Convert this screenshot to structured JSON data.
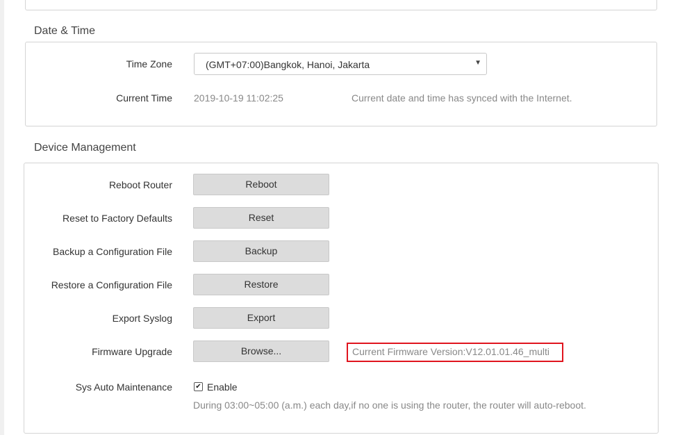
{
  "date_time": {
    "title": "Date & Time",
    "time_zone": {
      "label": "Time Zone",
      "selected": "(GMT+07:00)Bangkok, Hanoi, Jakarta"
    },
    "current_time": {
      "label": "Current Time",
      "value": "2019-10-19 11:02:25",
      "status": "Current date and time has synced with the Internet."
    }
  },
  "device_management": {
    "title": "Device Management",
    "rows": [
      {
        "label": "Reboot Router",
        "button": "Reboot"
      },
      {
        "label": "Reset to Factory Defaults",
        "button": "Reset"
      },
      {
        "label": "Backup a Configuration File",
        "button": "Backup"
      },
      {
        "label": "Restore a Configuration File",
        "button": "Restore"
      },
      {
        "label": "Export Syslog",
        "button": "Export"
      },
      {
        "label": "Firmware Upgrade",
        "button": "Browse..."
      }
    ],
    "firmware_version": "Current Firmware Version:V12.01.01.46_multi",
    "auto_maintenance": {
      "label": "Sys Auto Maintenance",
      "checkbox_label": "Enable",
      "checked": true,
      "note": "During 03:00~05:00 (a.m.) each day,if no one is using the router, the router will auto-reboot."
    }
  },
  "colors": {
    "highlight_border": "#e0141e",
    "button_bg": "#dcdcdc"
  }
}
